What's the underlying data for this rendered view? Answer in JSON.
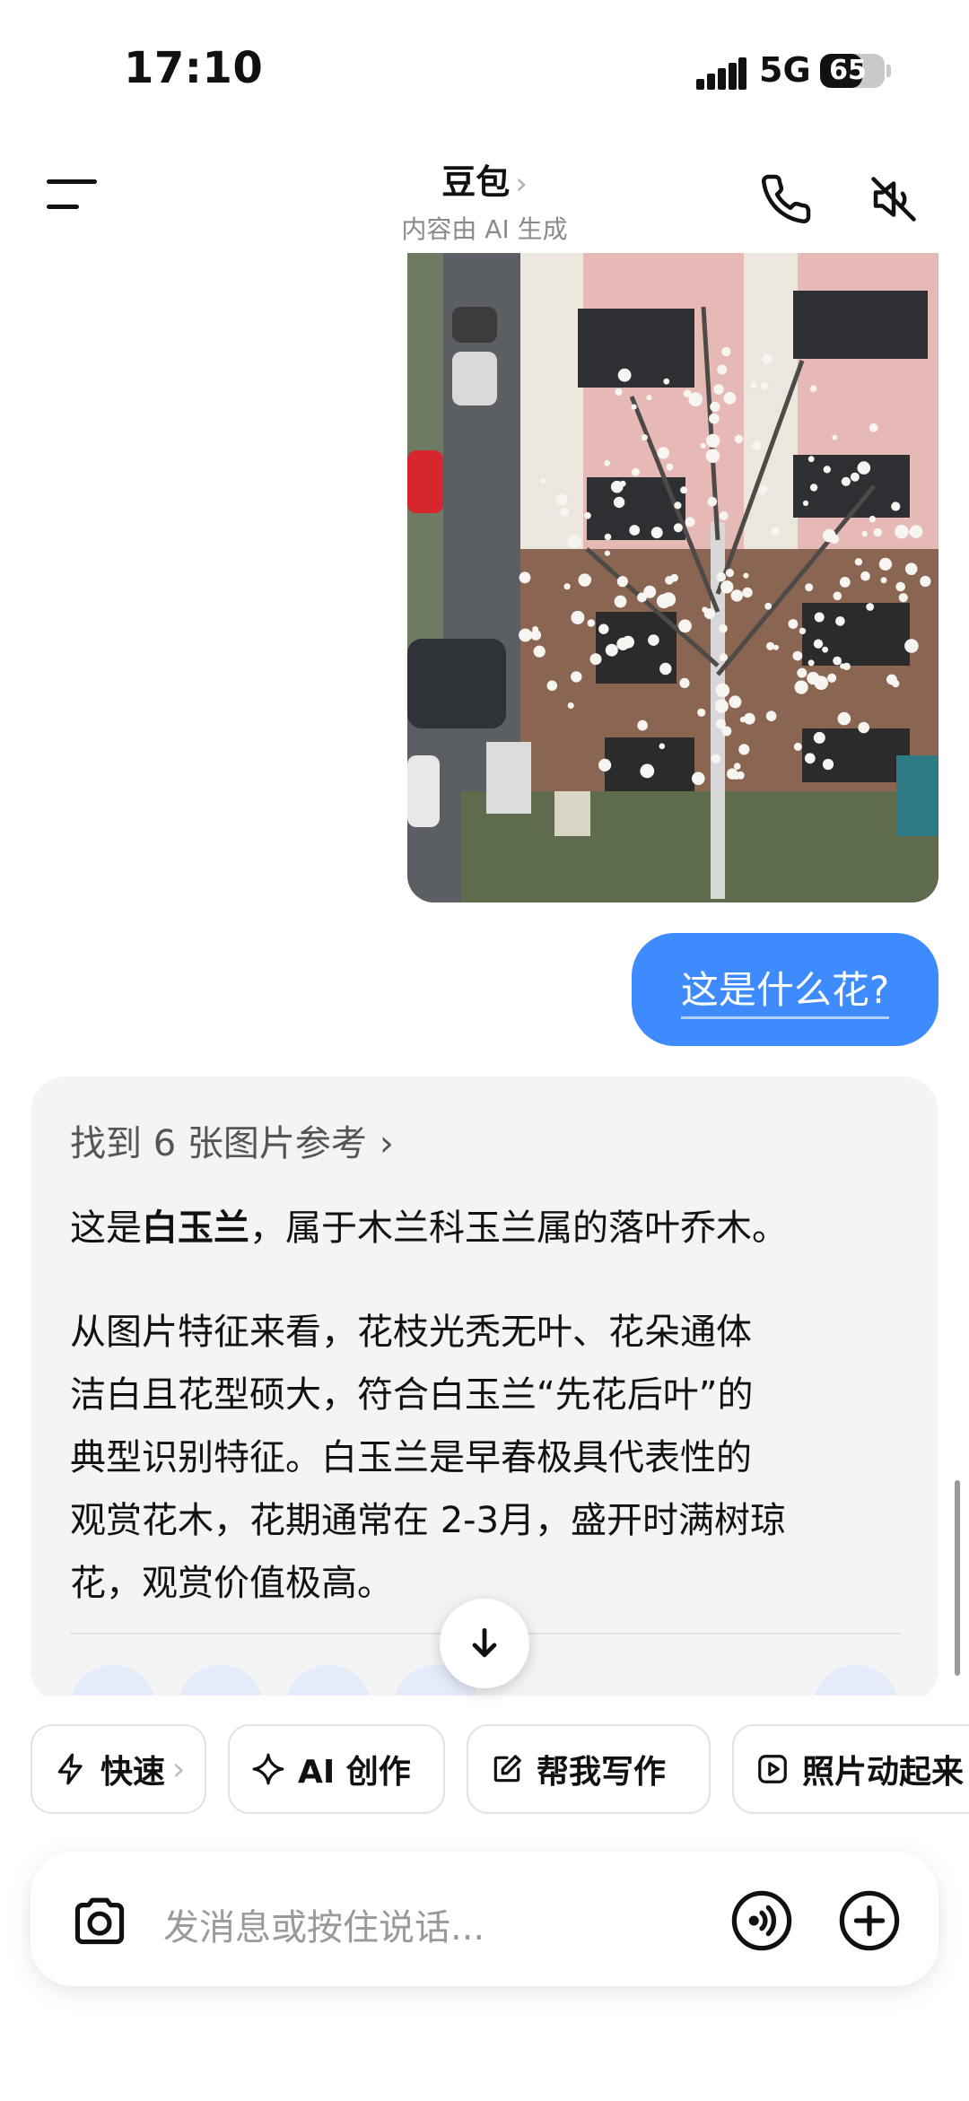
{
  "status_bar": {
    "time": "17:10",
    "network": "5G",
    "battery": "65",
    "battery_level": 0.65
  },
  "header": {
    "title": "豆包",
    "title_chevron": "›",
    "subtitle": "内容由 AI 生成"
  },
  "user_message": {
    "text": "这是什么花?"
  },
  "ai_message": {
    "references": "找到 6 张图片参考",
    "references_chevron": "›",
    "p1_before": "这是",
    "p1_bold": "白玉兰",
    "p1_after": "，属于木兰科玉兰属的落叶乔木。",
    "p2_line1": "从图片特征来看，花枝光秃无叶、花朵通体",
    "p2_line2": "洁白且花型硕大，符合白玉兰“先花后叶”的",
    "p2_line3": "典型识别特征。白玉兰是早春极具代表性的",
    "p2_line4": "观赏花木，花期通常在 2-3月，盛开时满树琼",
    "p2_line5": "花，观赏价值极高。"
  },
  "chips": [
    {
      "label": "快速",
      "icon": "lightning-icon",
      "chevron": "›"
    },
    {
      "label": "AI 创作",
      "icon": "sparkle-icon"
    },
    {
      "label": "帮我写作",
      "icon": "edit-icon"
    },
    {
      "label": "照片动起来",
      "icon": "play-icon"
    }
  ],
  "input": {
    "placeholder": "发消息或按住说话..."
  },
  "icons": {
    "menu": "menu-icon",
    "call": "phone-icon",
    "mute": "speaker-mute-icon",
    "camera": "camera-icon",
    "voice": "voice-icon",
    "add": "plus-icon",
    "scroll_down": "arrow-down-icon"
  },
  "colors": {
    "accent": "#3d8bff",
    "card_bg": "#f4f4f5"
  }
}
